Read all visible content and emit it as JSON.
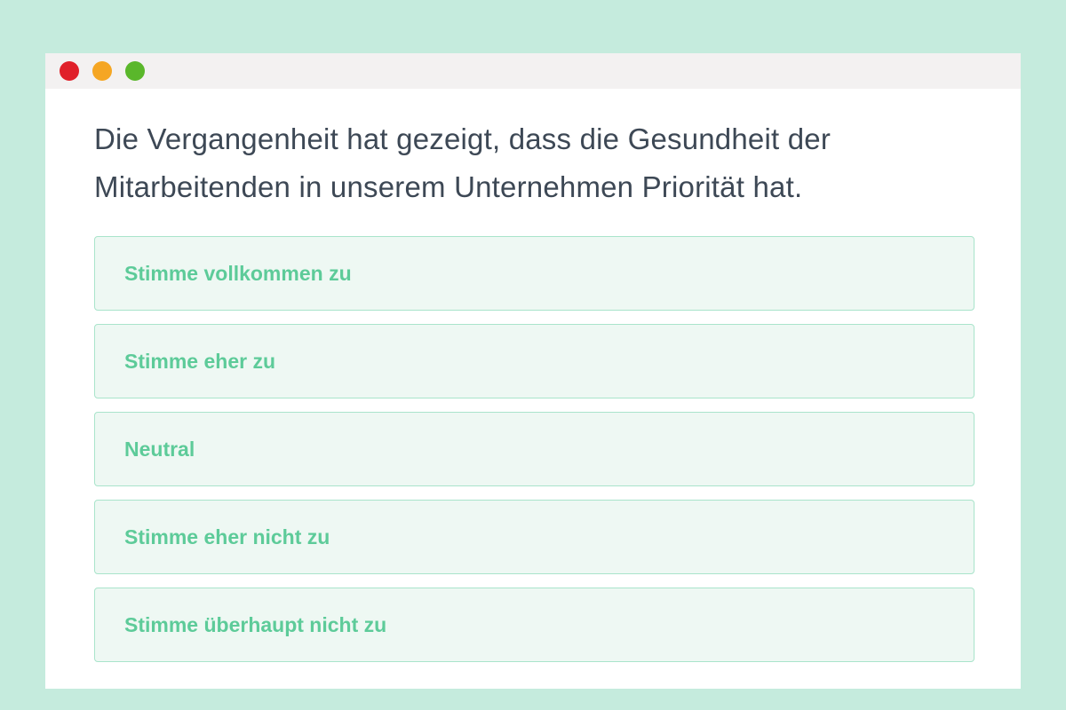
{
  "window": {
    "controls": [
      {
        "name": "close",
        "color": "#e0202a"
      },
      {
        "name": "minimize",
        "color": "#f5a623"
      },
      {
        "name": "maximize",
        "color": "#5ab72b"
      }
    ]
  },
  "survey": {
    "question": "Die Vergangenheit hat gezeigt, dass die Gesundheit der Mitarbeitenden in unserem Unternehmen Priorität hat.",
    "options": [
      {
        "label": "Stimme vollkommen zu"
      },
      {
        "label": "Stimme eher zu"
      },
      {
        "label": "Neutral"
      },
      {
        "label": "Stimme eher nicht zu"
      },
      {
        "label": "Stimme überhaupt nicht zu"
      }
    ]
  },
  "colors": {
    "page_background": "#c5ebdd",
    "question_text": "#3d4855",
    "option_text": "#5dcb99",
    "option_border": "#a9e4cb",
    "option_background": "#eef8f3"
  }
}
